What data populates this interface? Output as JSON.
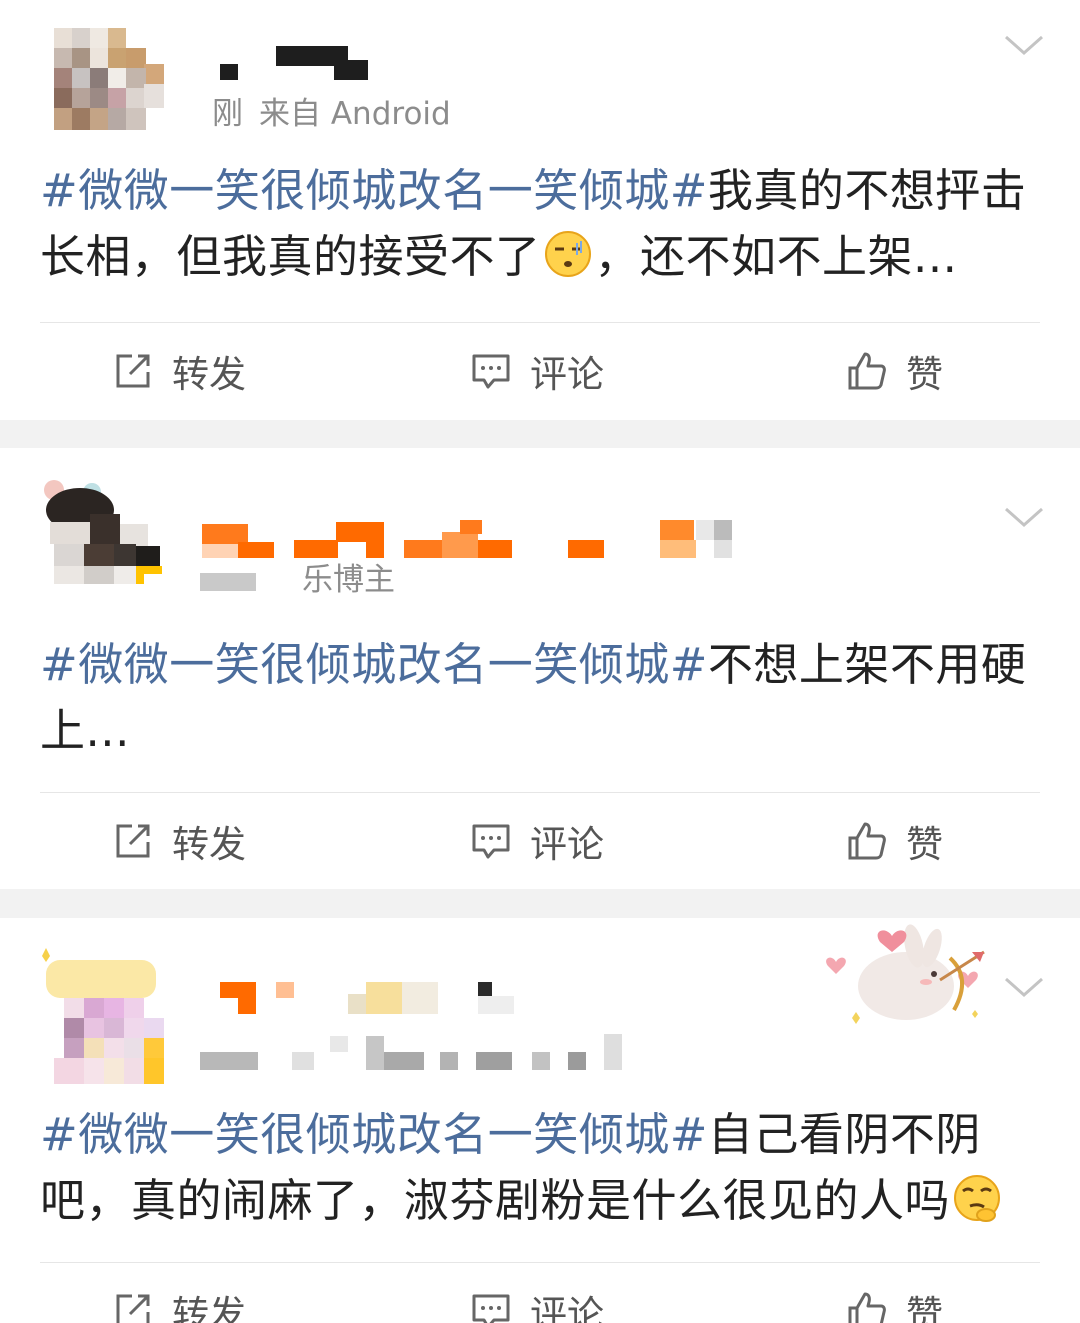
{
  "posts": [
    {
      "meta": "刚",
      "meta_prefix": "刚",
      "source": "来自 Android",
      "text_topic": "#微微一笑很倾城改名一笑倾城#",
      "text_before_emoji": "我真的不想抨击长相，但我真的接受不了",
      "text_after_emoji": "，还不如不上架...",
      "emoji": "sleepy-smirk-emoji"
    },
    {
      "meta": "乐博主",
      "text_topic": "#微微一笑很倾城改名一笑倾城#",
      "text_before_emoji": "不想上架不用硬上...",
      "text_after_emoji": ""
    },
    {
      "meta": "",
      "text_topic": "#微微一笑很倾城改名一笑倾城#",
      "text_before_emoji": "自己看阴不阴吧，真的闹麻了，淑芬剧粉是什么很见的人吗",
      "text_after_emoji": "",
      "emoji": "thinking-eyeroll-emoji",
      "sticker": "bunny-cupid-sticker"
    }
  ],
  "actions": {
    "repost": "转发",
    "comment": "评论",
    "like": "赞"
  },
  "icons": {
    "repost": "share-box-icon",
    "comment": "comment-bubble-icon",
    "like": "thumbs-up-icon",
    "menu": "chevron-down-icon"
  },
  "colors": {
    "topic": "#4c6d9c",
    "text": "#222222",
    "meta": "#8c8c8c",
    "separator": "#f2f2f2",
    "mosaic_orange": "#ff6a00"
  }
}
